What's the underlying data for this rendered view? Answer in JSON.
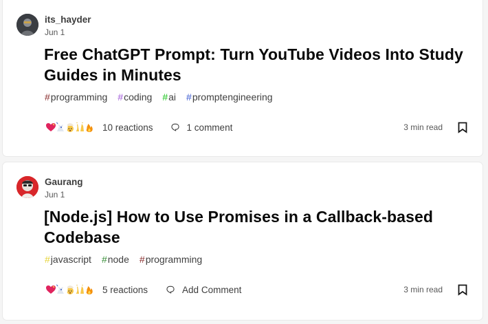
{
  "posts": [
    {
      "author": "its_hayder",
      "date": "Jun 1",
      "title": "Free ChatGPT Prompt: Turn YouTube Videos Into Study Guides in Minutes",
      "tags": [
        {
          "hash": "#",
          "name": "programming",
          "color": "#8a2f2f"
        },
        {
          "hash": "#",
          "name": "coding",
          "color": "#a35cd9"
        },
        {
          "hash": "#",
          "name": "ai",
          "color": "#16c318"
        },
        {
          "hash": "#",
          "name": "promptengineering",
          "color": "#3a5ad1"
        }
      ],
      "reactions_label": "10 reactions",
      "comments_label": "1 comment",
      "read_time": "3 min read"
    },
    {
      "author": "Gaurang",
      "date": "Jun 1",
      "title": "[Node.js] How to Use Promises in a Callback-based Codebase",
      "tags": [
        {
          "hash": "#",
          "name": "javascript",
          "color": "#e6d43b"
        },
        {
          "hash": "#",
          "name": "node",
          "color": "#3a8f3a"
        },
        {
          "hash": "#",
          "name": "programming",
          "color": "#8a2f2f"
        }
      ],
      "reactions_label": "5 reactions",
      "comments_label": "Add Comment",
      "read_time": "3 min read"
    }
  ],
  "reaction_icons": [
    "heart-icon",
    "unicorn-icon",
    "exploding-head-icon",
    "raised-hands-icon",
    "fire-icon"
  ],
  "colors": {
    "background": "#f5f5f5",
    "card": "#ffffff",
    "title": "#090909",
    "meta": "#575757"
  }
}
